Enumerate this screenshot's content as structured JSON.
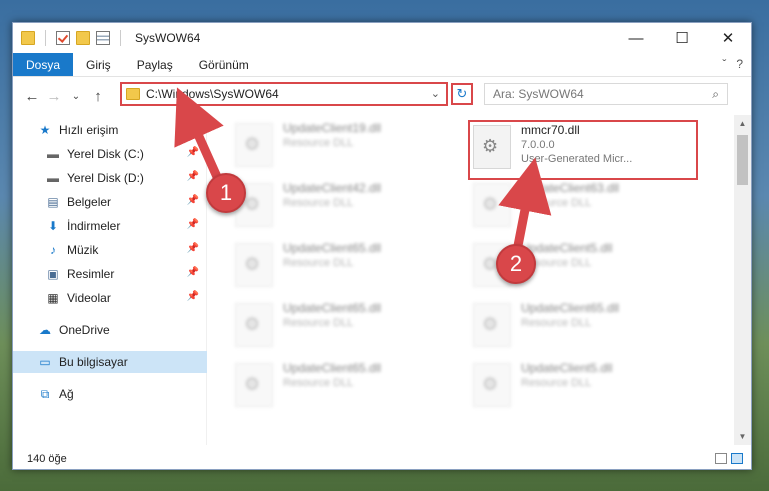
{
  "window": {
    "title": "SysWOW64"
  },
  "controls": {
    "minimize": "—",
    "maximize": "☐",
    "close": "✕"
  },
  "ribbon": {
    "tabs": [
      "Dosya",
      "Giriş",
      "Paylaş",
      "Görünüm"
    ],
    "collapse_icon": "ˇ",
    "help_icon": "?"
  },
  "nav": {
    "back": "←",
    "forward": "→",
    "recent": "⌄",
    "up": "↑"
  },
  "address": {
    "path": "C:\\Windows\\SysWOW64",
    "dropdown": "⌄",
    "refresh": "↻"
  },
  "search": {
    "placeholder": "Ara: SysWOW64",
    "icon": "⌕"
  },
  "sidebar": {
    "items": [
      {
        "label": "Hızlı erişim",
        "icon": "★",
        "pinned": false
      },
      {
        "label": "Yerel Disk (C:)",
        "icon": "▬",
        "pinned": true
      },
      {
        "label": "Yerel Disk (D:)",
        "icon": "▬",
        "pinned": true
      },
      {
        "label": "Belgeler",
        "icon": "▤",
        "pinned": true
      },
      {
        "label": "İndirmeler",
        "icon": "⬇",
        "pinned": true
      },
      {
        "label": "Müzik",
        "icon": "♪",
        "pinned": true
      },
      {
        "label": "Resimler",
        "icon": "▣",
        "pinned": true
      },
      {
        "label": "Videolar",
        "icon": "▦",
        "pinned": true
      },
      {
        "label": "OneDrive",
        "icon": "☁",
        "pinned": false
      },
      {
        "label": "Bu bilgisayar",
        "icon": "▭",
        "pinned": false
      },
      {
        "label": "Ağ",
        "icon": "⧉",
        "pinned": false
      }
    ],
    "pin_icon": "📌"
  },
  "files": {
    "col1": [
      {
        "name": "UpdateClient19.dll",
        "type": "Resource DLL"
      },
      {
        "name": "UpdateClient42.dll",
        "type": "Resource DLL"
      },
      {
        "name": "UpdateClient65.dll",
        "type": "Resource DLL"
      },
      {
        "name": "UpdateClient65.dll",
        "type": "Resource DLL"
      },
      {
        "name": "UpdateClient65.dll",
        "type": "Resource DLL"
      }
    ],
    "highlighted": {
      "name": "mmcr70.dll",
      "version": "7.0.0.0",
      "company": "User-Generated Micr..."
    },
    "col2": [
      {
        "name": "UpdateClient63.dll",
        "type": "Resource DLL"
      },
      {
        "name": "UpdateClient5.dll",
        "type": "Resource DLL"
      },
      {
        "name": "UpdateClient65.dll",
        "type": "Resource DLL"
      },
      {
        "name": "UpdateClient5.dll",
        "type": "Resource DLL"
      }
    ]
  },
  "status": {
    "count": "140 öğe"
  },
  "annotations": {
    "step1": "1",
    "step2": "2"
  },
  "colors": {
    "accent": "#1979ca",
    "highlight": "#d9474a",
    "selected": "#cce4f7"
  }
}
